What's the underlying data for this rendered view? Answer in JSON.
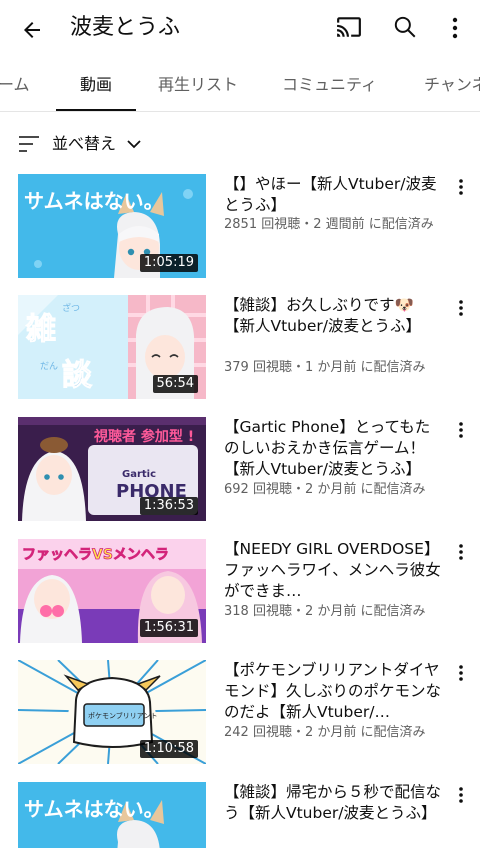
{
  "appbar": {
    "title": "波麦とうふ",
    "icons": [
      "back-arrow-icon",
      "cast-icon",
      "search-icon",
      "more-vert-icon"
    ]
  },
  "tabs": [
    "ーム",
    "動画",
    "再生リスト",
    "コミュニティ",
    "チャンネ"
  ],
  "active_tab": "動画",
  "sort": {
    "label": "並べ替え"
  },
  "thumb_text": {
    "t1": "サムネはない。",
    "t2a": "雑",
    "t2b": "談",
    "t2c": "ざつ",
    "t2d": "だん",
    "t3a": "視聴者 参加型 !",
    "t3b": "Gartic",
    "t3c": "PHONE",
    "t4": "ファッヘラVSメンヘラ",
    "t5": "ポケモンブリリアント",
    "t6": "サムネはない。"
  },
  "videos": [
    {
      "title": "【】やほー【新人Vtuber/波麦とうふ】",
      "meta": "2851 回視聴・2 週間前 に配信済み",
      "duration": "1:05:19"
    },
    {
      "title": "【雑談】お久しぶりです🐶【新人Vtuber/波麦とうふ】",
      "meta": "379 回視聴・1 か月前 に配信済み",
      "duration": "56:54"
    },
    {
      "title": "【Gartic Phone】とってもたのしいおえかき伝言ゲーム！【新人Vtuber/波麦とうふ】",
      "meta": "692 回視聴・2 か月前 に配信済み",
      "duration": "1:36:53"
    },
    {
      "title": "【NEEDY GIRL OVERDOSE】ファッヘラワイ、メンヘラ彼女ができま…",
      "meta": "318 回視聴・2 か月前 に配信済み",
      "duration": "1:56:31"
    },
    {
      "title": "【ポケモンブリリアントダイヤモンド】久しぶりのポケモンなのだよ【新人Vtuber/…",
      "meta": "242 回視聴・2 か月前 に配信済み",
      "duration": "1:10:58"
    },
    {
      "title": "【雑談】帰宅から５秒で配信なう【新人Vtuber/波麦とうふ】",
      "meta": "",
      "duration": ""
    }
  ]
}
